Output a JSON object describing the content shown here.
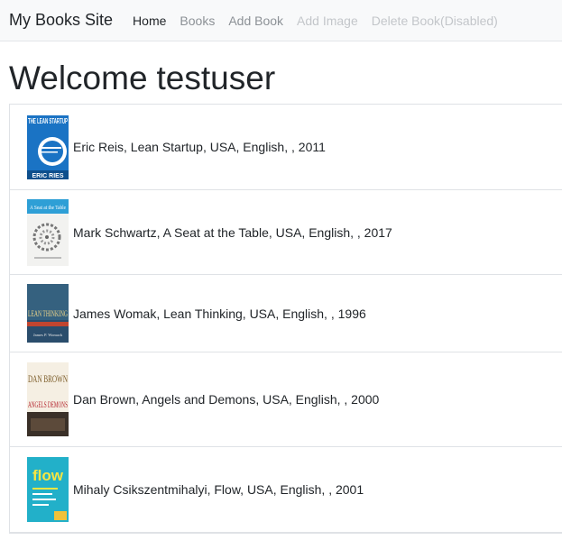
{
  "navbar": {
    "brand": "My Books Site",
    "links": [
      {
        "label": "Home",
        "state": "active"
      },
      {
        "label": "Books",
        "state": "normal"
      },
      {
        "label": "Add Book",
        "state": "normal"
      },
      {
        "label": "Add Image",
        "state": "disabled"
      },
      {
        "label": "Delete Book(Disabled)",
        "state": "disabled"
      }
    ]
  },
  "main": {
    "welcome_prefix": "Welcome",
    "username": "testuser"
  },
  "books": [
    {
      "text": "Eric Reis, Lean Startup, USA, English, , 2011",
      "cover_title": "THE LEAN STARTUP",
      "cover_author": "ERIC RIES",
      "cover_icon": "lean-startup-cover"
    },
    {
      "text": "Mark Schwartz, A Seat at the Table, USA, English, , 2017",
      "cover_title": "A Seat at the Table",
      "cover_icon": "seat-at-table-cover"
    },
    {
      "text": "James Womak, Lean Thinking, USA, English, , 1996",
      "cover_title": "LEAN THINKING",
      "cover_author": "James P. Womack",
      "cover_icon": "lean-thinking-cover"
    },
    {
      "text": "Dan Brown, Angels and Demons, USA, English, , 2000",
      "cover_title": "ANGELS DEMONS",
      "cover_author": "DAN BROWN",
      "cover_icon": "angels-demons-cover"
    },
    {
      "text": "Mihaly Csikszentmihalyi, Flow, USA, English, , 2001",
      "cover_title": "flow",
      "cover_icon": "flow-cover"
    }
  ]
}
